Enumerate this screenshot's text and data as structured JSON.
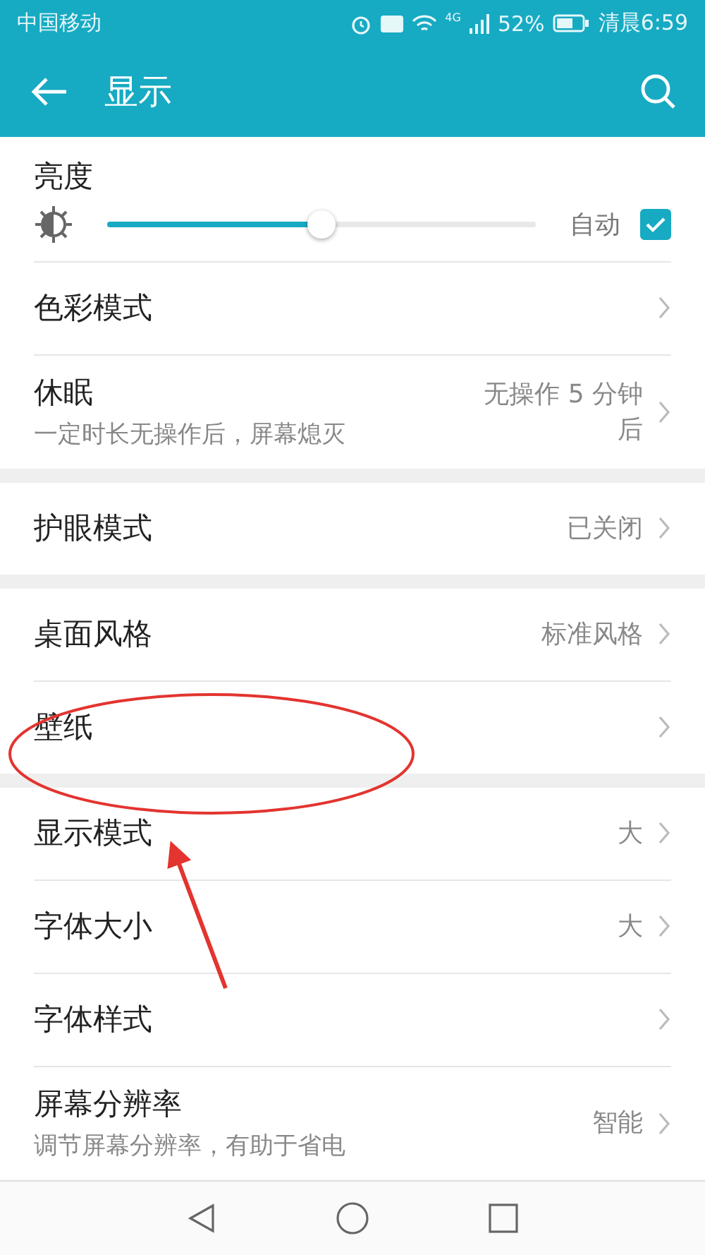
{
  "status_bar": {
    "carrier": "中国移动",
    "network": "4G",
    "battery": "52%",
    "time": "清晨6:59"
  },
  "header": {
    "title": "显示"
  },
  "sections": [
    {
      "items": [
        {
          "kind": "slider",
          "title": "亮度",
          "level": 0.5,
          "auto_label": "自动",
          "auto_checked": true
        },
        {
          "kind": "nav",
          "title": "色彩模式"
        },
        {
          "kind": "nav",
          "title": "休眠",
          "subtitle": "一定时长无操作后，屏幕熄灭",
          "value": "无操作 5 分钟后"
        }
      ]
    },
    {
      "items": [
        {
          "kind": "nav",
          "title": "护眼模式",
          "value": "已关闭"
        }
      ]
    },
    {
      "items": [
        {
          "kind": "nav",
          "title": "桌面风格",
          "value": "标准风格"
        },
        {
          "kind": "nav",
          "title": "壁纸"
        }
      ]
    },
    {
      "items": [
        {
          "kind": "nav",
          "title": "显示模式",
          "value": "大"
        },
        {
          "kind": "nav",
          "title": "字体大小",
          "value": "大"
        },
        {
          "kind": "nav",
          "title": "字体样式"
        },
        {
          "kind": "nav",
          "title": "屏幕分辨率",
          "subtitle": "调节屏幕分辨率，有助于省电",
          "value": "智能"
        }
      ]
    }
  ]
}
